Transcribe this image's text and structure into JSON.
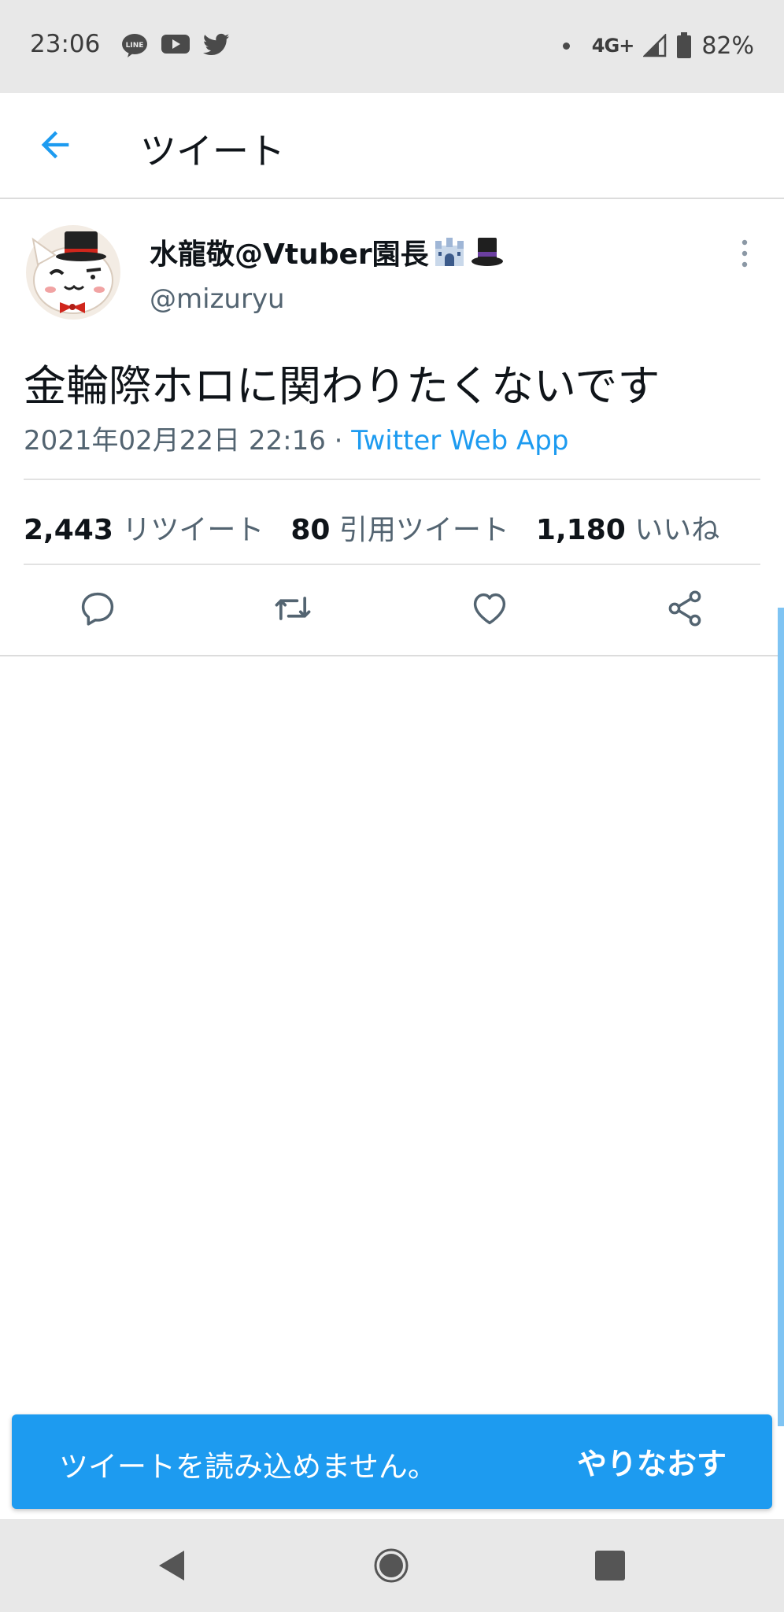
{
  "status_bar": {
    "time": "23:06",
    "notification_icons": [
      "line-icon",
      "youtube-icon",
      "twitter-icon"
    ],
    "network": "4G+",
    "battery": "82%"
  },
  "header": {
    "title": "ツイート"
  },
  "tweet": {
    "display_name": "水龍敬@Vtuber園長",
    "name_emojis": [
      "castle-emoji",
      "top-hat-emoji"
    ],
    "handle": "@mizuryu",
    "text": "金輪際ホロに関わりたくないです",
    "timestamp": "2021年02月22日 22:16",
    "separator": " · ",
    "client": "Twitter Web App",
    "stats": {
      "retweets_count": "2,443",
      "retweets_label": "リツイート",
      "quotes_count": "80",
      "quotes_label": "引用ツイート",
      "likes_count": "1,180",
      "likes_label": "いいね"
    }
  },
  "snackbar": {
    "message": "ツイートを読み込めません。",
    "action": "やりなおす"
  },
  "colors": {
    "accent": "#1d9bf0",
    "text_primary": "#0f1419",
    "text_secondary": "#536471",
    "system_bar": "#e8e8e8"
  }
}
